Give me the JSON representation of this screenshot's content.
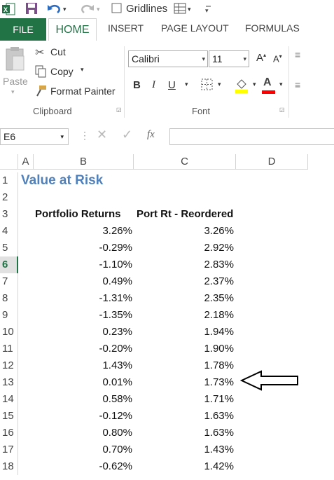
{
  "quick_access": {
    "gridlines_label": "Gridlines",
    "icons": [
      "excel-logo-icon",
      "save-icon",
      "undo-icon",
      "redo-icon",
      "checkbox-icon",
      "table-icon"
    ]
  },
  "tabs": {
    "file": "FILE",
    "home": "HOME",
    "insert": "INSERT",
    "page_layout": "PAGE LAYOUT",
    "formulas": "FORMULAS"
  },
  "clipboard": {
    "paste": "Paste",
    "cut": "Cut",
    "copy": "Copy",
    "format_painter": "Format Painter",
    "group_label": "Clipboard"
  },
  "font": {
    "family": "Calibri",
    "size": "11",
    "bold": "B",
    "italic": "I",
    "underline": "U",
    "font_color_label": "A",
    "group_label": "Font",
    "highlight_color": "#ffff00",
    "font_color": "#ff0000"
  },
  "formula_bar": {
    "name_box": "E6",
    "fx": "fx",
    "formula": ""
  },
  "columns": [
    "A",
    "B",
    "C",
    "D"
  ],
  "sheet": {
    "title": "Value at Risk",
    "header_b": "Portfolio Returns",
    "header_c": "Port Rt - Reordered",
    "rows": [
      {
        "row": "1"
      },
      {
        "row": "2"
      },
      {
        "row": "3"
      },
      {
        "row": "4",
        "b": "3.26%",
        "c": "3.26%"
      },
      {
        "row": "5",
        "b": "-0.29%",
        "c": "2.92%"
      },
      {
        "row": "6",
        "b": "-1.10%",
        "c": "2.83%"
      },
      {
        "row": "7",
        "b": "0.49%",
        "c": "2.37%"
      },
      {
        "row": "8",
        "b": "-1.31%",
        "c": "2.35%"
      },
      {
        "row": "9",
        "b": "-1.35%",
        "c": "2.18%"
      },
      {
        "row": "10",
        "b": "0.23%",
        "c": "1.94%"
      },
      {
        "row": "11",
        "b": "-0.20%",
        "c": "1.90%"
      },
      {
        "row": "12",
        "b": "1.43%",
        "c": "1.78%"
      },
      {
        "row": "13",
        "b": "0.01%",
        "c": "1.73%"
      },
      {
        "row": "14",
        "b": "0.58%",
        "c": "1.71%"
      },
      {
        "row": "15",
        "b": "-0.12%",
        "c": "1.63%"
      },
      {
        "row": "16",
        "b": "0.80%",
        "c": "1.63%"
      },
      {
        "row": "17",
        "b": "0.70%",
        "c": "1.43%"
      },
      {
        "row": "18",
        "b": "-0.62%",
        "c": "1.42%"
      }
    ]
  },
  "colors": {
    "excel_green": "#217346",
    "title_blue": "#4f81bd"
  }
}
